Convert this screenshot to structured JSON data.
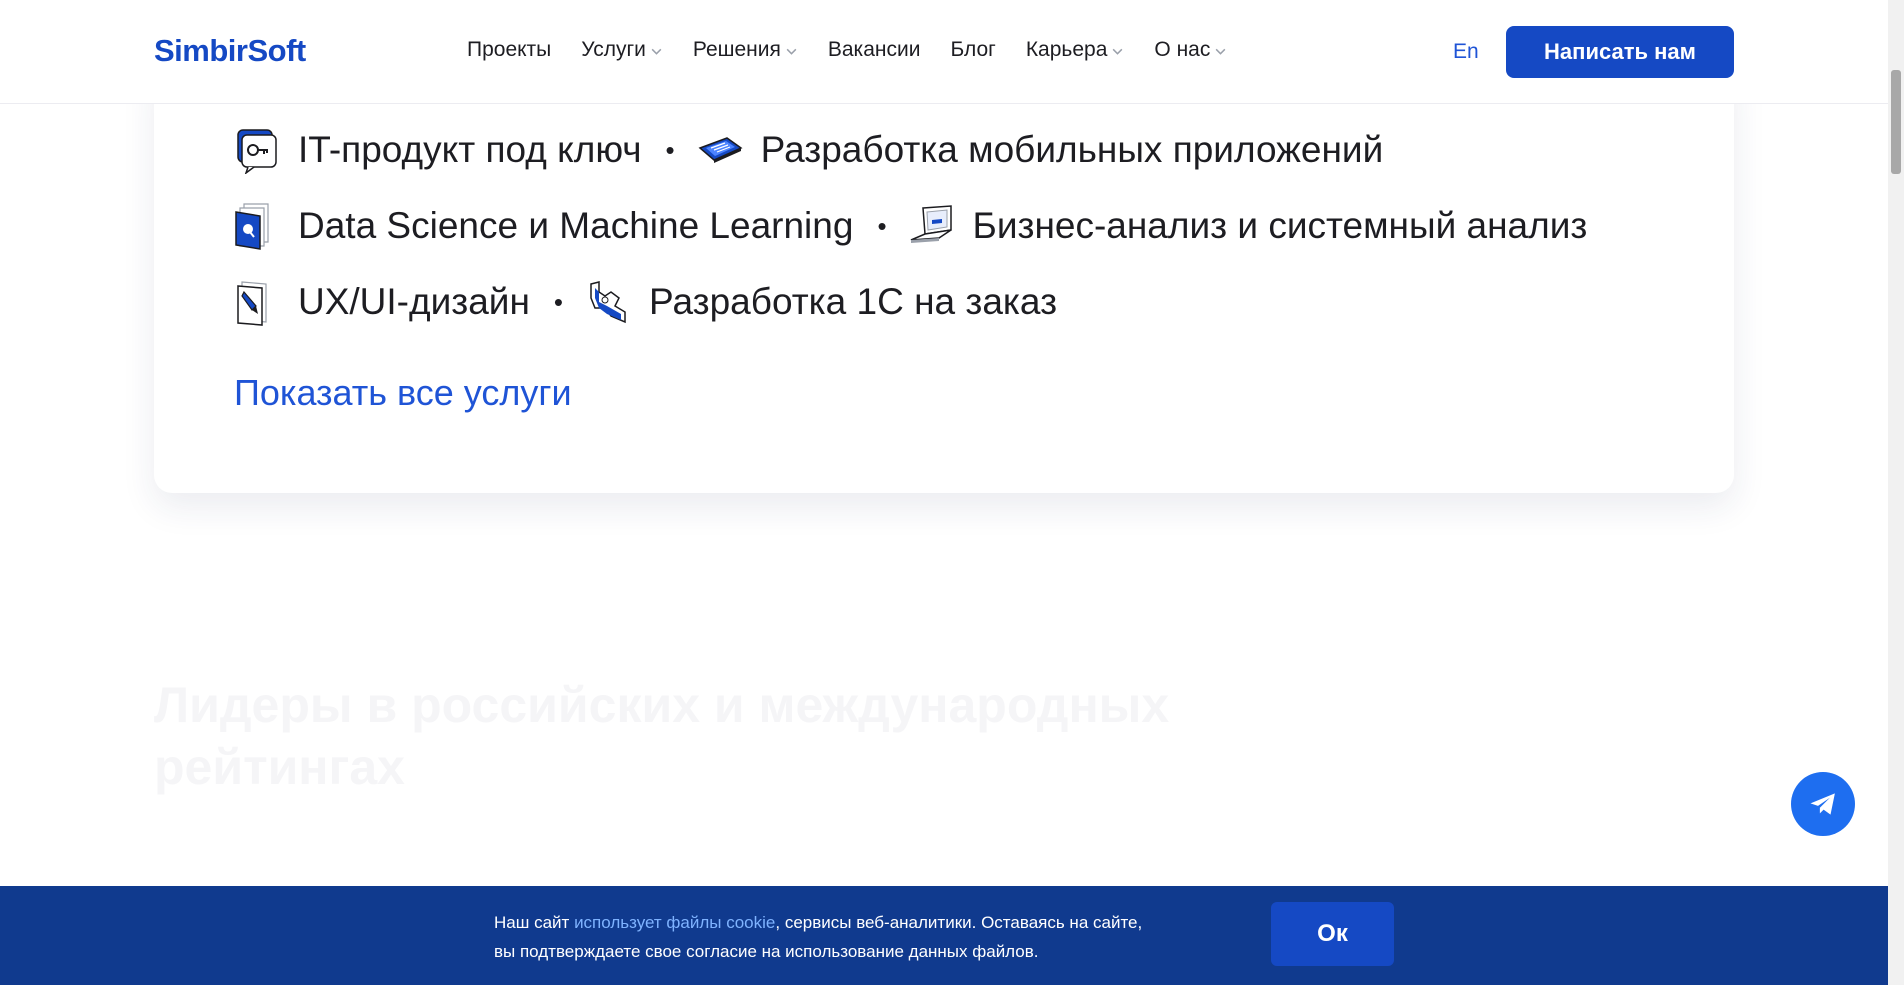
{
  "header": {
    "logo": "SimbirSoft",
    "nav": [
      {
        "label": "Проекты",
        "dropdown": false
      },
      {
        "label": "Услуги",
        "dropdown": true
      },
      {
        "label": "Решения",
        "dropdown": true
      },
      {
        "label": "Вакансии",
        "dropdown": false
      },
      {
        "label": "Блог",
        "dropdown": false
      },
      {
        "label": "Карьера",
        "dropdown": true
      },
      {
        "label": "О нас",
        "dropdown": true
      }
    ],
    "lang": "En",
    "cta": "Написать нам"
  },
  "services": {
    "rows": [
      [
        {
          "label": "IT-продукт под ключ",
          "icon": "key-chat-icon"
        },
        {
          "label": "Разработка мобильных приложений",
          "icon": "smartphone-icon"
        }
      ],
      [
        {
          "label": "Data Science и Machine Learning",
          "icon": "documents-icon"
        },
        {
          "label": "Бизнес-анализ и системный анализ",
          "icon": "laptop-icon"
        }
      ],
      [
        {
          "label": "UX/UI-дизайн",
          "icon": "design-pen-icon"
        },
        {
          "label": "Разработка 1С на заказ",
          "icon": "wrench-icon"
        }
      ]
    ],
    "separator": "•",
    "show_all": "Показать все услуги"
  },
  "leaders_heading": {
    "line1": "Лидеры в российских и международных",
    "line2": "рейтингах"
  },
  "fab": {
    "icon": "telegram-icon"
  },
  "cookie": {
    "text_before": "Наш сайт ",
    "link": "использует файлы cookie",
    "text_after": ", сервисы веб-аналитики. Оставаясь на сайте,",
    "line2": "вы подтверждаете свое согласие на использование данных файлов.",
    "ok": "Ок"
  },
  "colors": {
    "brand": "#1549c4",
    "link": "#1f54d6",
    "cookie_bg": "#103a8e",
    "cookie_link": "#7fb3ff",
    "fab": "#1e6ef0"
  }
}
